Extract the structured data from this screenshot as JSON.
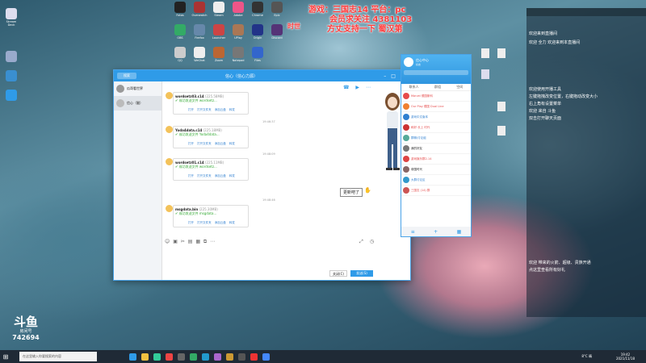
{
  "overlay": {
    "line1": "游戏：三国志14  平台：pc",
    "line2": "会员求关注 4381103",
    "line3": "方丈支持一下  蜀汉第",
    "sub": "时世"
  },
  "chat": {
    "title": "信心（信心力源）",
    "search_placeholder": "搜索",
    "contacts": [
      {
        "name": "瓜哥看世界",
        "sub": "22:01"
      },
      {
        "name": "信心（腿）",
        "sub": "22:01"
      }
    ],
    "messages": [
      {
        "file": "wordsetz03.c14",
        "meta": "(225.58MB)",
        "status": "成功发送文件 wordsetz...",
        "links": "打开  打开文件夹  添加云盘  转发"
      },
      {
        "file": "Yoda4data.c14",
        "meta": "(225.18MB)",
        "status": "成功发送文件 Yoda4data...",
        "links": "打开  打开文件夹  添加云盘  转发"
      },
      {
        "file": "wordsetz01.c14",
        "meta": "(225.11MB)",
        "status": "成功发送文件 wordsetz...",
        "links": "打开  打开文件夹  添加云盘  转发"
      },
      {
        "file": "msgdata.bin",
        "meta": "(225.30MB)",
        "status": "成功发送文件 msgdata...",
        "links": "打开  打开文件夹  添加云盘  转发"
      }
    ],
    "times": [
      "19:46:37",
      "19:48:09",
      "19:48:46"
    ],
    "bubble": "更新吧了",
    "close_label": "关闭(C)",
    "send_label": "发送(S)"
  },
  "friends": {
    "name": "信心中心",
    "status": "好友",
    "tabs": [
      "联系人",
      "群组",
      "空间"
    ],
    "rows": [
      {
        "name": "Marvel 德国斯科",
        "color": "#e64b4b"
      },
      {
        "name": "Our Play 德国 Dual Line",
        "color": "#e64b4b"
      },
      {
        "name": "游戏中文版本",
        "color": "#2f7fd0"
      },
      {
        "name": "和好-长上 时代",
        "color": "#e64b4b"
      },
      {
        "name": "群聊/讨论组",
        "color": "#2f7fd0"
      },
      {
        "name": "我的好友",
        "color": "#333"
      },
      {
        "name": "游戏娱乐群2-14",
        "color": "#e64b4b"
      },
      {
        "name": "帝国时代",
        "color": "#333"
      },
      {
        "name": "大群讨论区",
        "color": "#2f7fd0"
      },
      {
        "name": "三国志 (14) 群",
        "color": "#e64b4b"
      }
    ]
  },
  "rightpanel": {
    "lines": [
      "欢迎来到直播间",
      "欢迎 全力 欢迎来到本直播间",
      "欢迎使用开播工具",
      "左键拖拽改变位置，右键拖动改变大小",
      "右上角有设置菜单",
      "欢迎 来自 斗鱼",
      "双击打开聊天页面"
    ],
    "bottom": [
      "欢迎 带来的火箭、超级、贵族开通",
      "点这里查看所有好礼"
    ]
  },
  "logo": {
    "brand": "斗鱼",
    "room_label": "房间号",
    "room": "742694"
  },
  "taskbar": {
    "search": "在这里输入你要搜索的内容",
    "temp": "8°C 晴",
    "time": "19:42",
    "date": "2021/11/18"
  },
  "desktop_icons": [
    "Stream Deck",
    "Fotos",
    "Overwatch",
    "Steam",
    "Adobe",
    "Chrome",
    "Epic",
    "OBS",
    "Firefox",
    "Launcher",
    "UPlay",
    "Origin",
    "Discord",
    "QQ",
    "WeChat",
    "Zoom",
    "Notepad",
    "Files"
  ],
  "colors": {
    "accent": "#2f9be8",
    "overlay": "#ff3a3a"
  }
}
